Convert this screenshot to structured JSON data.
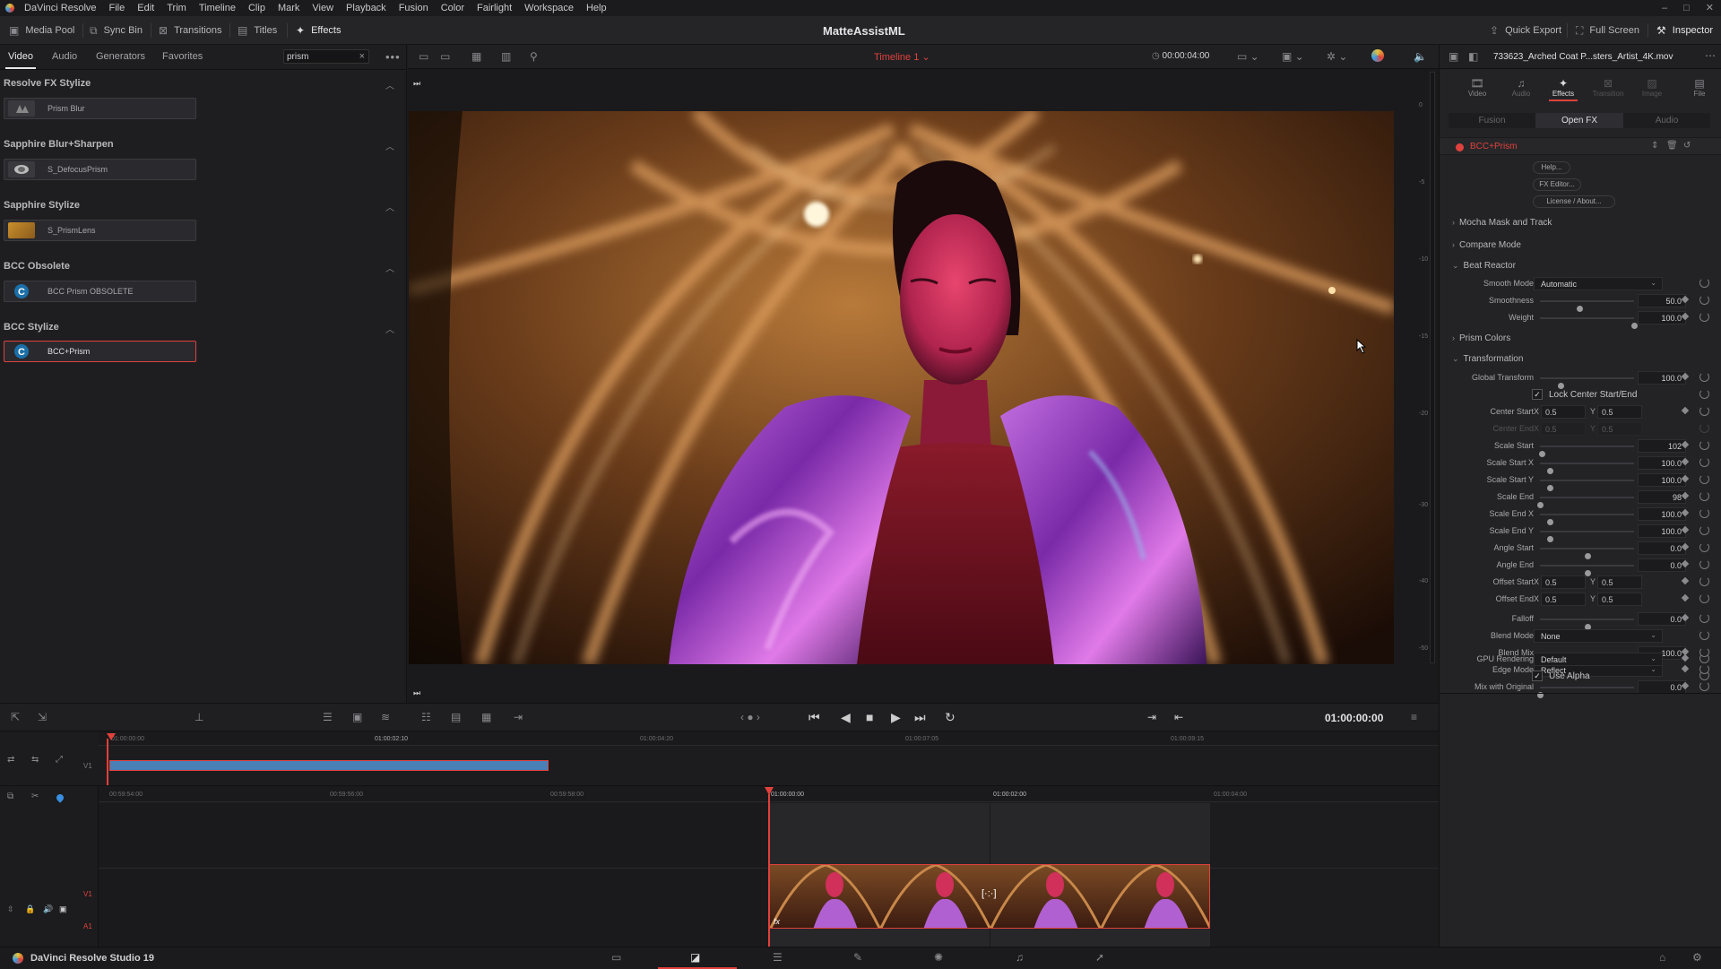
{
  "app": {
    "name": "DaVinci Resolve",
    "project_title": "MatteAssistML"
  },
  "menu": [
    "File",
    "Edit",
    "Trim",
    "Timeline",
    "Clip",
    "Mark",
    "View",
    "Playback",
    "Fusion",
    "Color",
    "Fairlight",
    "Workspace",
    "Help"
  ],
  "toolbar": {
    "media_pool": "Media Pool",
    "sync_bin": "Sync Bin",
    "transitions": "Transitions",
    "titles": "Titles",
    "effects": "Effects",
    "quick_export": "Quick Export",
    "full_screen": "Full Screen",
    "inspector": "Inspector"
  },
  "library": {
    "tabs": [
      "Video",
      "Audio",
      "Generators",
      "Favorites"
    ],
    "search": {
      "value": "prism",
      "clear": "×"
    },
    "groups": [
      {
        "title": "Resolve FX Stylize",
        "items": [
          "Prism Blur"
        ]
      },
      {
        "title": "Sapphire Blur+Sharpen",
        "items": [
          "S_DefocusPrism"
        ]
      },
      {
        "title": "Sapphire Stylize",
        "items": [
          "S_PrismLens"
        ]
      },
      {
        "title": "BCC Obsolete",
        "items": [
          "BCC Prism OBSOLETE"
        ]
      },
      {
        "title": "BCC Stylize",
        "items": [
          "BCC+Prism"
        ]
      }
    ]
  },
  "viewer": {
    "timeline_name": "Timeline 1",
    "timecode": "00:00:04:00",
    "playhead_timecode": "01:00:00:00",
    "meter_ticks": [
      "0",
      "-5",
      "-10",
      "-15",
      "-20",
      "-30",
      "-40",
      "-50"
    ]
  },
  "inspector": {
    "clip_name": "733623_Arched Coat P...sters_Artist_4K.mov",
    "tabs": [
      "Video",
      "Audio",
      "Effects",
      "Transition",
      "Image",
      "File"
    ],
    "subtabs": [
      "Fusion",
      "Open FX",
      "Audio"
    ],
    "effect_name": "BCC+Prism",
    "buttons": [
      "Help...",
      "FX Editor...",
      "License / About..."
    ],
    "sections": [
      "Mocha Mask and Track",
      "Compare Mode",
      "Beat Reactor",
      "Prism Colors",
      "Transformation"
    ],
    "smooth_mode": {
      "label": "Smooth Mode",
      "value": "Automatic"
    },
    "smoothness": {
      "label": "Smoothness",
      "value": "50.0",
      "level": 0.42
    },
    "weight": {
      "label": "Weight",
      "value": "100.0",
      "level": 1.0
    },
    "global_transform": {
      "label": "Global Transform",
      "value": "100.0",
      "level": 0.22
    },
    "lock_center": {
      "label": "Lock Center Start/End",
      "checked": "✓"
    },
    "center_start": {
      "label": "Center Start",
      "x": "0.5",
      "y": "0.5"
    },
    "center_end": {
      "label": "Center End",
      "x": "0.5",
      "y": "0.5"
    },
    "scale_start": {
      "label": "Scale Start",
      "value": "102",
      "level": 0.02
    },
    "scale_start_x": {
      "label": "Scale Start X",
      "value": "100.0",
      "level": 0.1
    },
    "scale_start_y": {
      "label": "Scale Start Y",
      "value": "100.0",
      "level": 0.1
    },
    "scale_end": {
      "label": "Scale End",
      "value": "98",
      "level": 0.0
    },
    "scale_end_x": {
      "label": "Scale End X",
      "value": "100.0",
      "level": 0.1
    },
    "scale_end_y": {
      "label": "Scale End Y",
      "value": "100.0",
      "level": 0.1
    },
    "angle_start": {
      "label": "Angle Start",
      "value": "0.0",
      "level": 0.5
    },
    "angle_end": {
      "label": "Angle End",
      "value": "0.0",
      "level": 0.5
    },
    "offset_start": {
      "label": "Offset Start",
      "x": "0.5",
      "y": "0.5"
    },
    "offset_end": {
      "label": "Offset End",
      "x": "0.5",
      "y": "0.5"
    },
    "falloff": {
      "label": "Falloff",
      "value": "0.0",
      "level": 0.5
    },
    "blend_mode": {
      "label": "Blend Mode",
      "value": "None"
    },
    "blend_mix": {
      "label": "Blend Mix",
      "value": "100.0",
      "level": 1.0
    },
    "edge_mode": {
      "label": "Edge Mode",
      "value": "Reflect"
    },
    "mix_with_original": {
      "label": "Mix with Original",
      "value": "0.0",
      "level": 0.0
    },
    "gpu_rendering": {
      "label": "GPU Rendering",
      "value": "Default"
    },
    "use_alpha": {
      "label": "Use Alpha",
      "checked": "✓"
    },
    "xy_x": "X",
    "xy_y": "Y"
  },
  "timeline": {
    "upper_ticks": [
      "01:00:00:00",
      "01:00:02:10",
      "01:00:04:20",
      "01:00:07:05",
      "01:00:09:15"
    ],
    "lower_ticks": [
      "00:59:54:00",
      "00:59:56:00",
      "00:59:58:00",
      "01:00:00:00",
      "01:00:02:00",
      "01:00:04:00"
    ],
    "track_v1": "V1",
    "track_a1": "A1",
    "fx_badge": "fx"
  },
  "status": {
    "version": "DaVinci Resolve Studio 19"
  },
  "colors": {
    "accent": "#e0413c",
    "selected_outline": "#e0413c",
    "timeline_clip": "#4a7fb8"
  }
}
